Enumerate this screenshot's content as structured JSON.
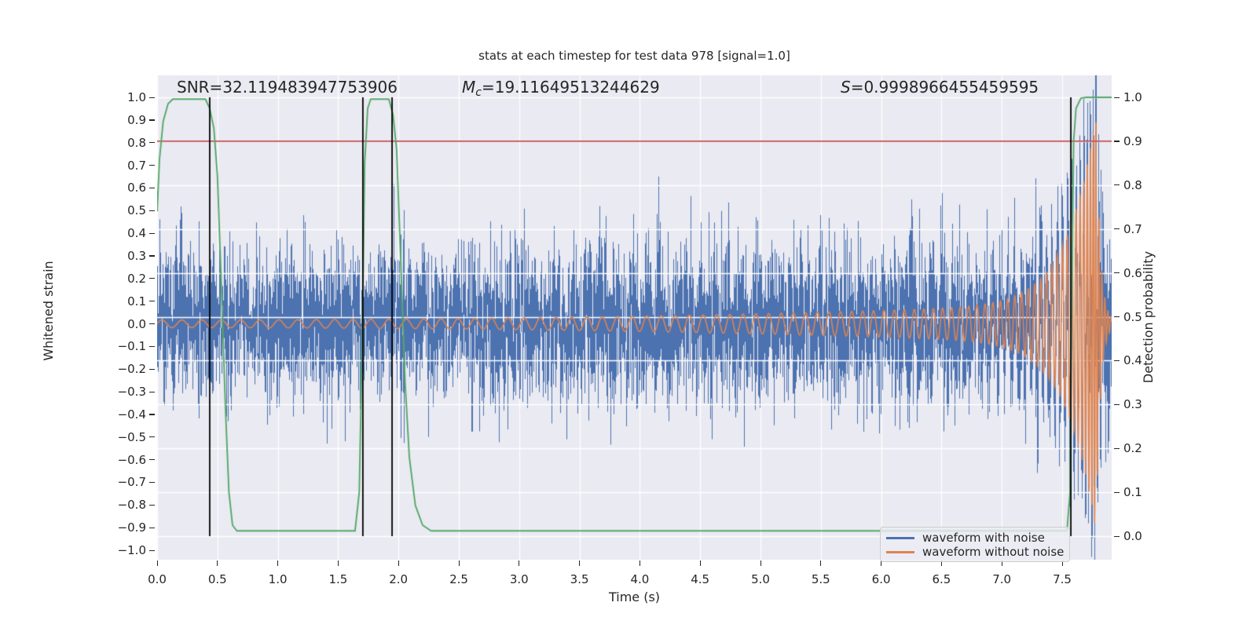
{
  "title": "stats at each timestep for test data 978 [signal=1.0]",
  "annotations": {
    "snr": {
      "text": "SNR=32.119483947753906"
    },
    "mc": {
      "var": "M",
      "sub": "c",
      "value": "=19.11649513244629"
    },
    "s": {
      "var": "S",
      "value": "=0.9998966455459595"
    }
  },
  "axes": {
    "xlabel": "Time (s)",
    "ylabel_left": "Whitened strain",
    "ylabel_right": "Detection probability"
  },
  "legend": {
    "items": [
      {
        "label": "waveform with noise",
        "color": "#4c72b0"
      },
      {
        "label": "waveform without noise",
        "color": "#dd8452"
      }
    ]
  },
  "colors": {
    "plot_background": "#eaeaf2",
    "grid": "#ffffff",
    "noise_waveform": "#4c72b0",
    "clean_waveform": "#dd8452",
    "detection_curve": "#55a868",
    "threshold_line": "#c44e52",
    "event_marker": "#000000",
    "text": "#262626"
  },
  "chart_data": {
    "type": "line",
    "title": "stats at each timestep for test data 978 [signal=1.0]",
    "xlabel": "Time (s)",
    "ylabel_left": "Whitened strain",
    "ylabel_right": "Detection probability",
    "xlim": [
      0.0,
      7.91
    ],
    "ylim_left": [
      -1.04,
      1.1
    ],
    "ylim_right": [
      -0.05,
      1.05
    ],
    "grid": true,
    "x_tick_values": [
      0.0,
      0.5,
      1.0,
      1.5,
      2.0,
      2.5,
      3.0,
      3.5,
      4.0,
      4.5,
      5.0,
      5.5,
      6.0,
      6.5,
      7.0,
      7.5
    ],
    "x_tick_labels": [
      "0.0",
      "0.5",
      "1.0",
      "1.5",
      "2.0",
      "2.5",
      "3.0",
      "3.5",
      "4.0",
      "4.5",
      "5.0",
      "5.5",
      "6.0",
      "6.5",
      "7.0",
      "7.5"
    ],
    "y_left_tick_values": [
      1.0,
      0.9,
      0.8,
      0.7,
      0.6,
      0.5,
      0.4,
      0.3,
      0.2,
      0.1,
      0.0,
      -0.1,
      -0.2,
      -0.3,
      -0.4,
      -0.5,
      -0.6,
      -0.7,
      -0.8,
      -0.9,
      -1.0
    ],
    "y_left_tick_labels": [
      "1.0",
      "0.9",
      "0.8",
      "0.7",
      "0.6",
      "0.5",
      "0.4",
      "0.3",
      "0.2",
      "0.1",
      "0.0",
      "−0.1",
      "−0.2",
      "−0.3",
      "−0.4",
      "−0.5",
      "−0.6",
      "−0.7",
      "−0.8",
      "−0.9",
      "−1.0"
    ],
    "y_right_tick_values": [
      1.0,
      0.9,
      0.8,
      0.7,
      0.6,
      0.5,
      0.4,
      0.3,
      0.2,
      0.1,
      0.0
    ],
    "y_right_tick_labels": [
      "1.0",
      "0.9",
      "0.8",
      "0.7",
      "0.6",
      "0.5",
      "0.4",
      "0.3",
      "0.2",
      "0.1",
      "0.0"
    ],
    "threshold": {
      "axis": "right",
      "value": 0.9
    },
    "event_markers": {
      "times": [
        0.436,
        1.705,
        1.947,
        7.572
      ],
      "span_probability": [
        0.0,
        1.0
      ]
    },
    "detection_curve": {
      "name": "detection probability",
      "axis": "right",
      "points": [
        [
          0.0,
          0.74
        ],
        [
          0.02,
          0.86
        ],
        [
          0.05,
          0.945
        ],
        [
          0.09,
          0.985
        ],
        [
          0.13,
          0.996
        ],
        [
          0.4,
          0.996
        ],
        [
          0.435,
          0.975
        ],
        [
          0.47,
          0.93
        ],
        [
          0.5,
          0.82
        ],
        [
          0.535,
          0.55
        ],
        [
          0.565,
          0.3
        ],
        [
          0.595,
          0.1
        ],
        [
          0.625,
          0.025
        ],
        [
          0.66,
          0.012
        ],
        [
          1.64,
          0.012
        ],
        [
          1.675,
          0.1
        ],
        [
          1.7,
          0.45
        ],
        [
          1.72,
          0.85
        ],
        [
          1.745,
          0.975
        ],
        [
          1.77,
          0.996
        ],
        [
          1.92,
          0.996
        ],
        [
          1.955,
          0.96
        ],
        [
          1.985,
          0.88
        ],
        [
          2.02,
          0.62
        ],
        [
          2.055,
          0.35
        ],
        [
          2.09,
          0.18
        ],
        [
          2.14,
          0.07
        ],
        [
          2.2,
          0.025
        ],
        [
          2.27,
          0.012
        ],
        [
          7.54,
          0.012
        ],
        [
          7.565,
          0.1
        ],
        [
          7.58,
          0.55
        ],
        [
          7.595,
          0.9
        ],
        [
          7.615,
          0.975
        ],
        [
          7.655,
          0.998
        ],
        [
          7.7,
          1.0
        ],
        [
          7.91,
          1.0
        ]
      ]
    },
    "series": [
      {
        "name": "waveform with noise",
        "axis": "left",
        "kind": "stochastic",
        "noise_sigma": 0.17,
        "samples_per_column": 5,
        "seed": 978,
        "typical_envelope": 0.55,
        "core_band": 0.22
      },
      {
        "name": "waveform without noise",
        "axis": "left",
        "kind": "chirp",
        "base_amplitude": 0.018,
        "peak_amplitude": 0.92,
        "merger_time": 7.78,
        "base_frequency_hz": 6,
        "ringdown_decay": 28
      }
    ]
  }
}
